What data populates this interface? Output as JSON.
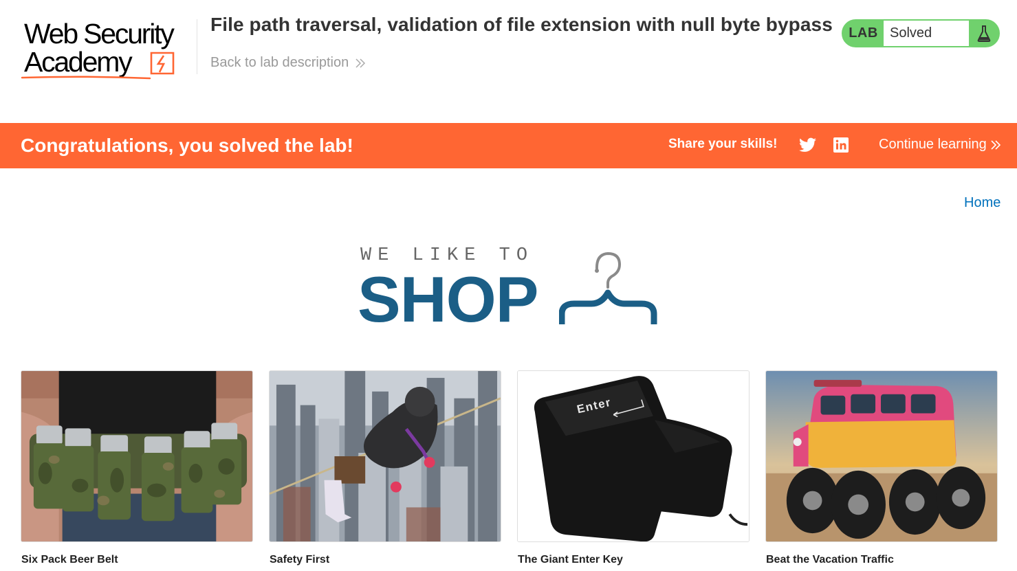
{
  "academy": {
    "logo_line1": "Web Security",
    "logo_line2": "Academy",
    "lab_title": "File path traversal, validation of file extension with null byte bypass",
    "back_link": "Back to lab description",
    "lab_badge": "LAB",
    "lab_status": "Solved",
    "accent_color": "#ff6633",
    "status_color": "#70d16d"
  },
  "banner": {
    "message": "Congratulations, you solved the lab!",
    "share_label": "Share your skills!",
    "continue_label": "Continue learning"
  },
  "nav": {
    "home": "Home"
  },
  "shop_logo": {
    "tagline": "WE LIKE TO",
    "word": "SHOP",
    "color": "#1b5e86"
  },
  "products": [
    {
      "name": "Six Pack Beer Belt"
    },
    {
      "name": "Safety First"
    },
    {
      "name": "The Giant Enter Key"
    },
    {
      "name": "Beat the Vacation Traffic"
    }
  ]
}
